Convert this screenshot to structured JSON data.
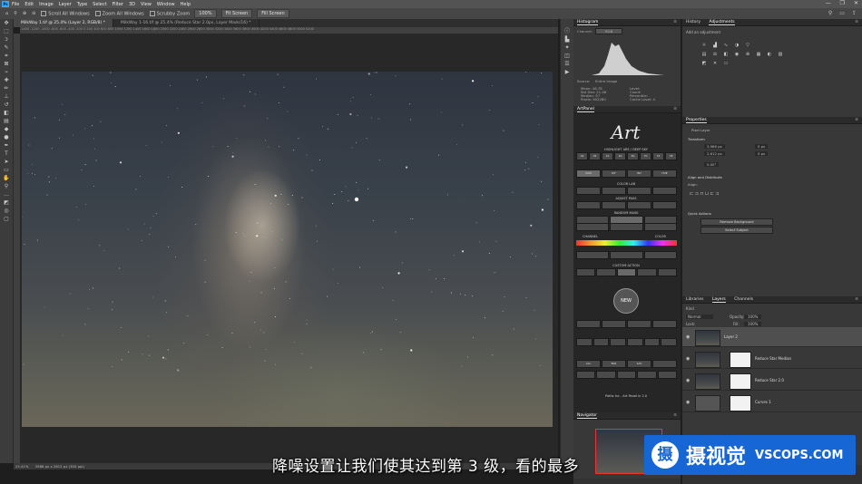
{
  "menubar": {
    "logo": "Ps",
    "items": [
      "File",
      "Edit",
      "Image",
      "Layer",
      "Type",
      "Select",
      "Filter",
      "3D",
      "View",
      "Window",
      "Help"
    ],
    "window_controls": [
      "—",
      "❐",
      "✕"
    ]
  },
  "options_bar": {
    "scroll_all": "Scroll All Windows",
    "zoom_all": "Zoom All Windows",
    "scrubby_zoom": "Scrubby Zoom",
    "zoom_level": "100%",
    "fit_screen": "Fit Screen",
    "fill_screen": "Fill Screen"
  },
  "tabs": [
    {
      "label": "MilkWay 1.tif @ 25.4% (Layer 2, RGB/8) *",
      "active": true
    },
    {
      "label": "MilkWay 1-16.tif @ 25.4% (Reduce Star 2.0px, Layer Mask/16) *",
      "active": false
    }
  ],
  "status": {
    "zoom": "25.41%",
    "doc": "3986 px x 2612 px (300 ppi)"
  },
  "histogram": {
    "title": "Histogram",
    "channel_label": "Channel:",
    "channel": "RGB",
    "source_label": "Source:",
    "source": "Entire Image",
    "stats": [
      "Mean: 46.78",
      "Std Dev: 21.46",
      "Median: 57",
      "Pixels: 902280",
      "Level:",
      "Count:",
      "Percentile:",
      "Cache Level: 4"
    ]
  },
  "artpanel": {
    "title": "ArtPanel",
    "logo": "Art",
    "sub": "panel",
    "version": "Paths Inc - Art Panel in 2.0",
    "sections": {
      "highlight": "HIGHLIGHT ARE / DEEP SKY",
      "numbers": [
        "02",
        "05",
        "10",
        "20",
        "50",
        "70",
        "72",
        "78"
      ],
      "mode_buttons": [
        "SUM",
        "DIF",
        "INT",
        "HUE"
      ],
      "color_lab": "COLOR LAB",
      "adjust": "ADJUST PASS",
      "random": "RANDOM MASK",
      "channel": "CHANNEL",
      "color": "COLOR",
      "new": "NEW",
      "custom": "CUSTOM ACTION",
      "feather": "ALL",
      "blur_row": [
        "ALL",
        "BLR",
        "SAV"
      ]
    }
  },
  "navigator": {
    "title": "Navigator"
  },
  "adjustments": {
    "tab_history": "History",
    "tab_adjustments": "Adjustments",
    "add_label": "Add an adjustment"
  },
  "properties": {
    "title": "Properties",
    "kind": "Pixel Layer",
    "transform": "Transform",
    "w": "3,986 px",
    "h": "2,612 px",
    "x": "0 px",
    "y": "0 px",
    "angle": "0.00°",
    "align": "Align and Distribute",
    "align_sub": "Align:",
    "quick": "Quick Actions",
    "remove_bg": "Remove Background",
    "select_subject": "Select Subject"
  },
  "layers": {
    "tabs": [
      "Libraries",
      "Layers",
      "Channels"
    ],
    "kind": "Kind",
    "blend": "Normal",
    "opacity_label": "Opacity:",
    "opacity": "100%",
    "lock_label": "Lock:",
    "fill_label": "Fill:",
    "fill": "100%",
    "rows": [
      {
        "name": "Layer 2",
        "mask": false,
        "selected": true
      },
      {
        "name": "Reduce Star Median",
        "mask": true,
        "selected": false
      },
      {
        "name": "Reduce Star 2.0",
        "mask": true,
        "selected": false
      },
      {
        "name": "Curves 1",
        "mask": true,
        "selected": false
      }
    ]
  },
  "subtitle": "降噪设置让我们使其达到第 3 级，看的最多",
  "watermark": {
    "mark": "摄",
    "cn": "摄视觉",
    "en": "VSCOPS.COM"
  }
}
